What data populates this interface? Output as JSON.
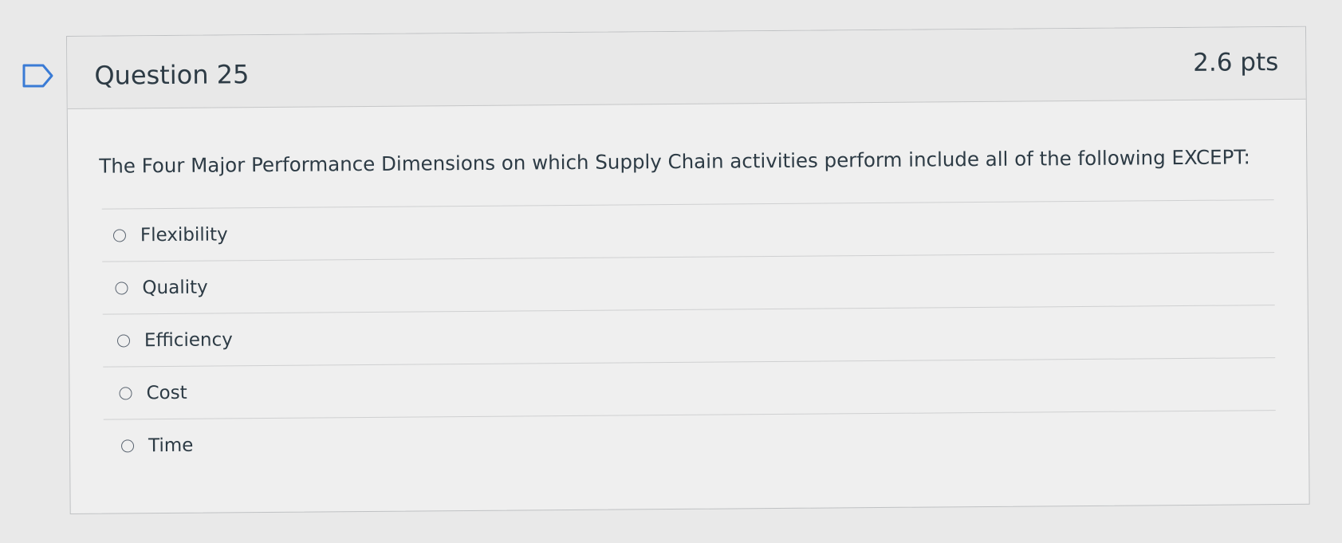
{
  "question": {
    "title": "Question 25",
    "points": "2.6 pts",
    "text": "The Four Major Performance Dimensions on which Supply Chain activities perform include all of the following EXCEPT:",
    "flag_icon": "flag-outline-icon"
  },
  "answers": [
    {
      "label": "Flexibility"
    },
    {
      "label": "Quality"
    },
    {
      "label": "Efficiency"
    },
    {
      "label": "Cost"
    },
    {
      "label": "Time"
    }
  ]
}
